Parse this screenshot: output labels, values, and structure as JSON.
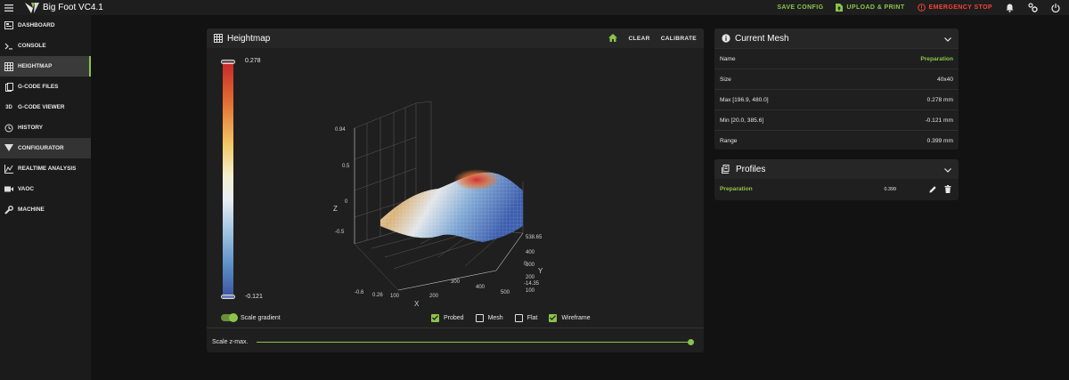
{
  "app": {
    "title": "Big Foot VC4.1"
  },
  "topbar": {
    "save_config": "SAVE CONFIG",
    "upload_print": "UPLOAD & PRINT",
    "emergency_stop": "EMERGENCY STOP",
    "icons": [
      "menu-icon",
      "bell-icon",
      "settings-icon",
      "power-icon"
    ]
  },
  "sidebar": {
    "items": [
      {
        "label": "DASHBOARD",
        "icon": "dashboard-icon"
      },
      {
        "label": "CONSOLE",
        "icon": "console-icon"
      },
      {
        "label": "HEIGHTMAP",
        "icon": "grid-icon",
        "active": true
      },
      {
        "label": "G-CODE FILES",
        "icon": "files-icon"
      },
      {
        "label": "G-CODE VIEWER",
        "icon": "3d-icon"
      },
      {
        "label": "HISTORY",
        "icon": "history-icon"
      },
      {
        "label": "CONFIGURATOR",
        "icon": "configurator-icon",
        "highlight": true
      },
      {
        "label": "REALTIME ANALYSIS",
        "icon": "chart-icon"
      },
      {
        "label": "VAOC",
        "icon": "camera-icon"
      },
      {
        "label": "MACHINE",
        "icon": "wrench-icon"
      }
    ],
    "glyph_3d": "3D"
  },
  "heightmap": {
    "title": "Heightmap",
    "clear": "CLEAR",
    "calibrate": "CALIBRATE",
    "gradient_max": "0.278",
    "gradient_min": "-0.121",
    "scale_gradient": "Scale gradient",
    "scale_gradient_on": true,
    "options": [
      {
        "label": "Probed",
        "checked": true
      },
      {
        "label": "Mesh",
        "checked": false
      },
      {
        "label": "Flat",
        "checked": false
      },
      {
        "label": "Wireframe",
        "checked": true
      }
    ],
    "scale_zmax": "Scale z-max.",
    "scale_zmax_value": 1.0,
    "plot": {
      "z_ticks": [
        "0.94",
        "0.5",
        "0",
        "-0.5"
      ],
      "x_ticks": [
        "-0.6",
        "0.26",
        "100",
        "200",
        "300",
        "400",
        "500"
      ],
      "y_ticks": [
        "538.65",
        "400",
        "300",
        "200",
        "100",
        "0",
        "-14.35"
      ],
      "z_label": "Z",
      "x_label": "X",
      "y_label": "Y"
    }
  },
  "current_mesh": {
    "title": "Current Mesh",
    "rows": [
      {
        "key": "Name",
        "value": "Preparation"
      },
      {
        "key": "Size",
        "value": "40x40"
      },
      {
        "key": "Max [196.9, 480.0]",
        "value": "0.278 mm"
      },
      {
        "key": "Min [20.0, 385.6]",
        "value": "-0.121 mm"
      },
      {
        "key": "Range",
        "value": "0.399 mm"
      }
    ]
  },
  "profiles": {
    "title": "Profiles",
    "items": [
      {
        "name": "Preparation",
        "range": "0.399"
      }
    ]
  },
  "colors": {
    "accent": "#8bc34a",
    "danger": "#f44336",
    "bg": "#121212",
    "card": "#1f1f1f"
  }
}
